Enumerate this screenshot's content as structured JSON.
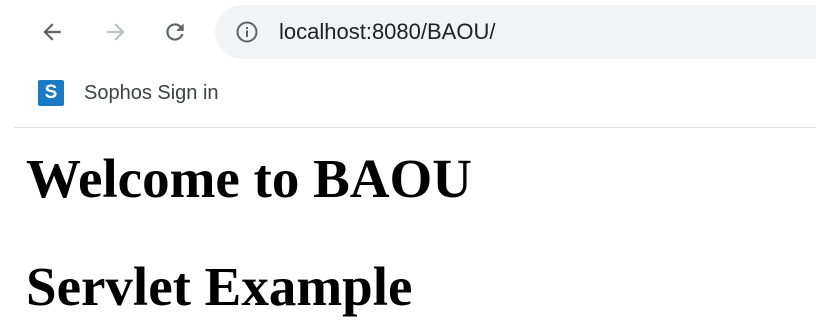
{
  "browser": {
    "url": "localhost:8080/BAOU/",
    "nav": {
      "back_icon": "arrow-left-icon",
      "forward_icon": "arrow-right-icon",
      "reload_icon": "reload-icon",
      "site_info_icon": "info-icon"
    }
  },
  "bookmarks": [
    {
      "label": "Sophos Sign in",
      "favicon_letter": "S",
      "favicon_color": "#1a7ac4"
    }
  ],
  "page": {
    "heading1": "Welcome to BAOU",
    "heading2": "Servlet Example"
  }
}
